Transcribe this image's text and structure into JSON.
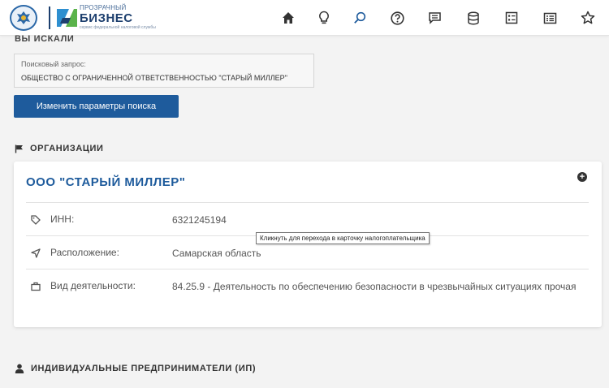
{
  "header": {
    "logo": {
      "top_text": "ПРОЗРАЧНЫЙ",
      "main_text": "БИЗНЕС",
      "sub_text": "сервис федеральной налоговой службы"
    },
    "nav_icons": [
      "home-icon",
      "lightbulb-icon",
      "search-icon",
      "help-icon",
      "message-icon",
      "database-icon",
      "form-icon",
      "list-icon",
      "star-icon"
    ],
    "accent_color": "#1e5b9c"
  },
  "search": {
    "section_title": "ВЫ ИСКАЛИ",
    "query_label": "Поисковый запрос:",
    "query_value": "ОБЩЕСТВО С ОГРАНИЧЕННОЙ ОТВЕТСТВЕННОСТЬЮ \"СТАРЫЙ МИЛЛЕР\"",
    "change_button": "Изменить параметры поиска"
  },
  "organizations": {
    "section_title": "ОРГАНИЗАЦИИ",
    "card": {
      "title": "ООО \"СТАРЫЙ МИЛЛЕР\"",
      "rows": [
        {
          "icon": "tag-icon",
          "label": "ИНН:",
          "value": "6321245194"
        },
        {
          "icon": "location-arrow-icon",
          "label": "Расположение:",
          "value": "Самарская область"
        },
        {
          "icon": "briefcase-icon",
          "label": "Вид деятельности:",
          "value": "84.25.9 - Деятельность по обеспечению безопасности в чрезвычайных ситуациях прочая"
        }
      ]
    },
    "tooltip": "Кликнуть для перехода в карточку налогоплательщика"
  },
  "entrepreneurs": {
    "section_title": "ИНДИВИДУАЛЬНЫЕ ПРЕДПРИНИМАТЕЛИ (ИП)"
  }
}
